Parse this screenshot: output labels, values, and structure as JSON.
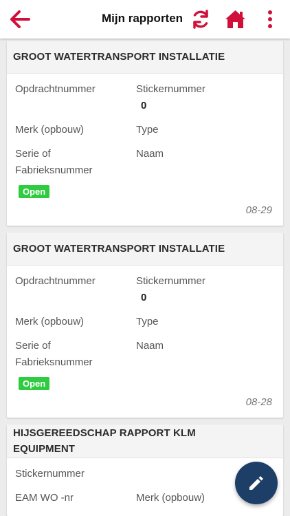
{
  "header": {
    "title": "Mijn rapporten",
    "icons": [
      "arrow-left-icon",
      "refresh-icon",
      "home-icon",
      "more-vertical-icon"
    ]
  },
  "colors": {
    "accent": "#d0103a",
    "fab": "#1d3e67",
    "badge": "#2ecc40"
  },
  "cards": [
    {
      "title": "GROOT WATERTRANSPORT INSTALLATIE",
      "labels": {
        "opdracht": "Opdrachtnummer",
        "sticker": "Stickernummer",
        "merk": "Merk (opbouw)",
        "type": "Type",
        "serie1": "Serie of",
        "serie2": "Fabrieksnummer",
        "naam": "Naam"
      },
      "sticker_value": "0",
      "status": "Open",
      "date": "08-29"
    },
    {
      "title": "GROOT WATERTRANSPORT INSTALLATIE",
      "labels": {
        "opdracht": "Opdrachtnummer",
        "sticker": "Stickernummer",
        "merk": "Merk (opbouw)",
        "type": "Type",
        "serie1": "Serie of",
        "serie2": "Fabrieksnummer",
        "naam": "Naam"
      },
      "sticker_value": "0",
      "status": "Open",
      "date": "08-28"
    },
    {
      "title_line1": "HIJSGEREEDSCHAP RAPPORT KLM",
      "title_line2": "EQUIPMENT",
      "labels": {
        "sticker": "Stickernummer",
        "eam": "EAM WO -nr",
        "merk": "Merk (opbouw)"
      }
    }
  ],
  "fab": {
    "icon": "pencil-icon"
  }
}
